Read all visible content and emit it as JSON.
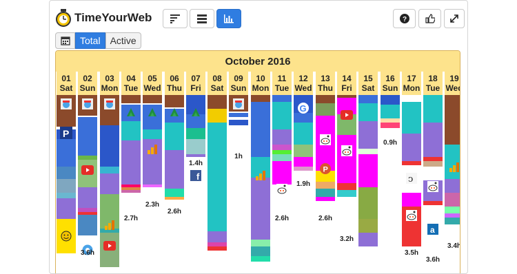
{
  "app": {
    "title": "TimeYourWeb"
  },
  "toolbar": {
    "buttons": [
      {
        "name": "sort-button",
        "icon": "sort-icon",
        "active": false
      },
      {
        "name": "list-button",
        "icon": "list-icon",
        "active": false
      },
      {
        "name": "chart-button",
        "icon": "bar-chart-icon",
        "active": true
      }
    ],
    "right_buttons": [
      {
        "name": "help-button",
        "icon": "question-icon"
      },
      {
        "name": "like-button",
        "icon": "thumbs-up-icon"
      },
      {
        "name": "expand-button",
        "icon": "expand-icon"
      }
    ]
  },
  "tabs": {
    "total": "Total",
    "active": "Active"
  },
  "calendar": {
    "month": "October 2016",
    "days": [
      {
        "date": "01",
        "dow": "Sat",
        "hours": ""
      },
      {
        "date": "02",
        "dow": "Sun",
        "hours": "3.6h"
      },
      {
        "date": "03",
        "dow": "Mon",
        "hours": ""
      },
      {
        "date": "04",
        "dow": "Tue",
        "hours": "2.7h"
      },
      {
        "date": "05",
        "dow": "Wed",
        "hours": "2.3h"
      },
      {
        "date": "06",
        "dow": "Thu",
        "hours": "2.6h"
      },
      {
        "date": "07",
        "dow": "Fri",
        "hours": "1.4h"
      },
      {
        "date": "08",
        "dow": "Sat",
        "hours": ""
      },
      {
        "date": "09",
        "dow": "Sun",
        "hours": "1h"
      },
      {
        "date": "10",
        "dow": "Mon",
        "hours": ""
      },
      {
        "date": "11",
        "dow": "Tue",
        "hours": "2.6h"
      },
      {
        "date": "12",
        "dow": "Wed",
        "hours": "1.9h"
      },
      {
        "date": "13",
        "dow": "Thu",
        "hours": "2.6h"
      },
      {
        "date": "14",
        "dow": "Fri",
        "hours": "3.2h"
      },
      {
        "date": "15",
        "dow": "Sat",
        "hours": ""
      },
      {
        "date": "16",
        "dow": "Sun",
        "hours": "0.9h"
      },
      {
        "date": "17",
        "dow": "Mon",
        "hours": "3.5h"
      },
      {
        "date": "18",
        "dow": "Tue",
        "hours": "3.6h"
      },
      {
        "date": "19",
        "dow": "Wed",
        "hours": "3.4h"
      }
    ]
  },
  "colors": {
    "accent": "#2f7de1",
    "header_bg": "#fde38c",
    "border": "#d9b15a"
  }
}
